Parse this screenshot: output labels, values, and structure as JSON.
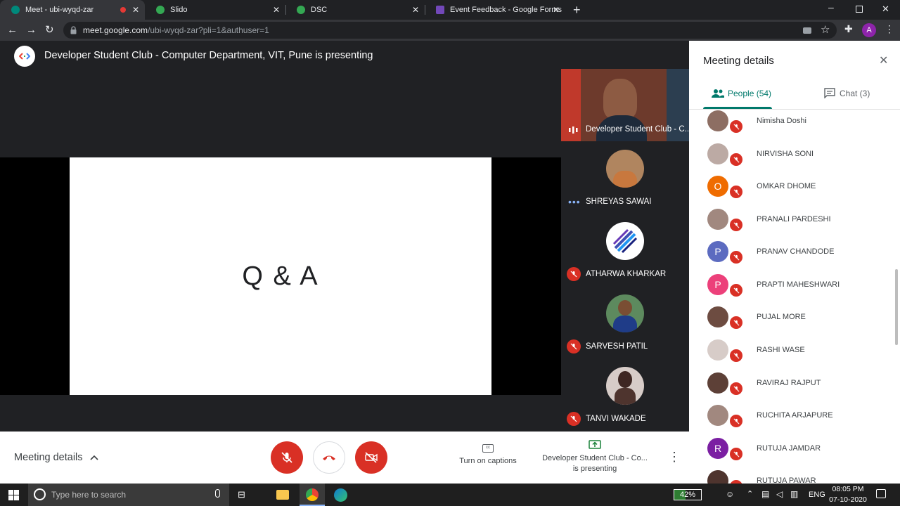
{
  "browser": {
    "tabs": [
      {
        "title": "Meet - ubi-wyqd-zar",
        "active": true,
        "fav_color": "#00897b"
      },
      {
        "title": "Slido",
        "active": false,
        "fav_color": "#34a853"
      },
      {
        "title": "DSC",
        "active": false,
        "fav_color": "#34a853"
      },
      {
        "title": "Event Feedback - Google Forms",
        "active": false,
        "fav_color": "#7248b9"
      }
    ],
    "url_host": "meet.google.com",
    "url_path": "/ubi-wyqd-zar?pli=1&authuser=1",
    "profile_initial": "A"
  },
  "meet": {
    "presenting_text": "Developer Student Club - Computer Department, VIT, Pune is presenting",
    "slide_text": "Q & A",
    "tiles": [
      {
        "name": "Developer Student Club - C..."
      },
      {
        "name": "SHREYAS SAWAI"
      },
      {
        "name": "ATHARWA KHARKAR"
      },
      {
        "name": "SARVESH PATIL"
      },
      {
        "name": "TANVI WAKADE"
      }
    ],
    "bottom": {
      "meeting_details": "Meeting details",
      "captions": "Turn on captions",
      "presenting_line1": "Developer Student Club - Co...",
      "presenting_line2": "is presenting"
    }
  },
  "panel": {
    "title": "Meeting details",
    "tab_people": "People (54)",
    "tab_chat": "Chat (3)",
    "people": [
      {
        "name": "Nimisha Doshi",
        "initial": "",
        "color": "#8d6e63"
      },
      {
        "name": "NIRVISHA SONI",
        "initial": "",
        "color": "#bcaaa4"
      },
      {
        "name": "OMKAR DHOME",
        "initial": "O",
        "color": "#ef6c00"
      },
      {
        "name": "PRANALI PARDESHI",
        "initial": "",
        "color": "#a1887f"
      },
      {
        "name": "PRANAV CHANDODE",
        "initial": "P",
        "color": "#5c6bc0"
      },
      {
        "name": "PRAPTI MAHESHWARI",
        "initial": "P",
        "color": "#ec407a"
      },
      {
        "name": "PUJAL MORE",
        "initial": "",
        "color": "#6d4c41"
      },
      {
        "name": "RASHI WASE",
        "initial": "",
        "color": "#d7ccc8"
      },
      {
        "name": "RAVIRAJ RAJPUT",
        "initial": "",
        "color": "#5d4037"
      },
      {
        "name": "RUCHITA ARJAPURE",
        "initial": "",
        "color": "#a1887f"
      },
      {
        "name": "RUTUJA JAMDAR",
        "initial": "R",
        "color": "#7b1fa2"
      },
      {
        "name": "RUTUJA PAWAR",
        "initial": "",
        "color": "#4e342e"
      }
    ]
  },
  "taskbar": {
    "search_placeholder": "Type here to search",
    "battery": "42%",
    "lang": "ENG",
    "time": "08:05 PM",
    "date": "07-10-2020"
  }
}
